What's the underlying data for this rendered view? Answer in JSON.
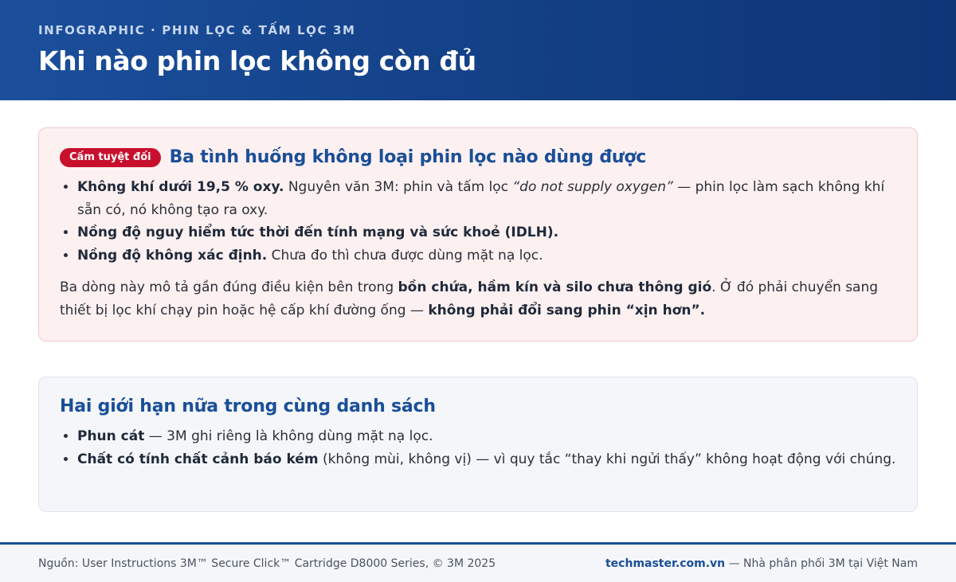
{
  "header": {
    "eyebrow": "INFOGRAPHIC · PHIN LỌC & TẤM LỌC 3M",
    "title": "Khi nào phin lọc không còn đủ"
  },
  "danger_card": {
    "badge": "Cấm tuyệt đối",
    "title": "Ba tình huống không loại phin lọc nào dùng được",
    "items": [
      {
        "bold": "Không khí dưới 19,5 % oxy.",
        "text_a": " Nguyên văn 3M: phin và tấm lọc ",
        "italic": "“do not supply oxygen”",
        "text_b": " — phin lọc làm sạch không khí sẵn có, nó không tạo ra oxy."
      },
      {
        "bold": "Nồng độ nguy hiểm tức thời đến tính mạng và sức khoẻ (IDLH)."
      },
      {
        "bold": "Nồng độ không xác định.",
        "text_a": " Chưa đo thì chưa được dùng mặt nạ lọc."
      }
    ],
    "paragraph": {
      "text_a": "Ba dòng này mô tả gần đúng điều kiện bên trong ",
      "bold_a": "bồn chứa, hầm kín và silo chưa thông gió",
      "text_b": ". Ở đó phải chuyển sang thiết bị lọc khí chạy pin hoặc hệ cấp khí đường ống — ",
      "bold_b": "không phải đổi sang phin “xịn hơn”."
    }
  },
  "info_card": {
    "title": "Hai giới hạn nữa trong cùng danh sách",
    "items": [
      {
        "bold": "Phun cát",
        "text_a": " — 3M ghi riêng là không dùng mặt nạ lọc."
      },
      {
        "bold": "Chất có tính chất cảnh báo kém",
        "text_a": " (không mùi, không vị) — vì quy tắc “thay khi ngửi thấy” không hoạt động với chúng."
      }
    ]
  },
  "footer": {
    "source": "Nguồn: User Instructions 3M™ Secure Click™ Cartridge D8000 Series, © 3M 2025",
    "brand": "techmaster.com.vn",
    "brand_suffix": " — Nhà phân phối 3M tại Việt Nam"
  }
}
